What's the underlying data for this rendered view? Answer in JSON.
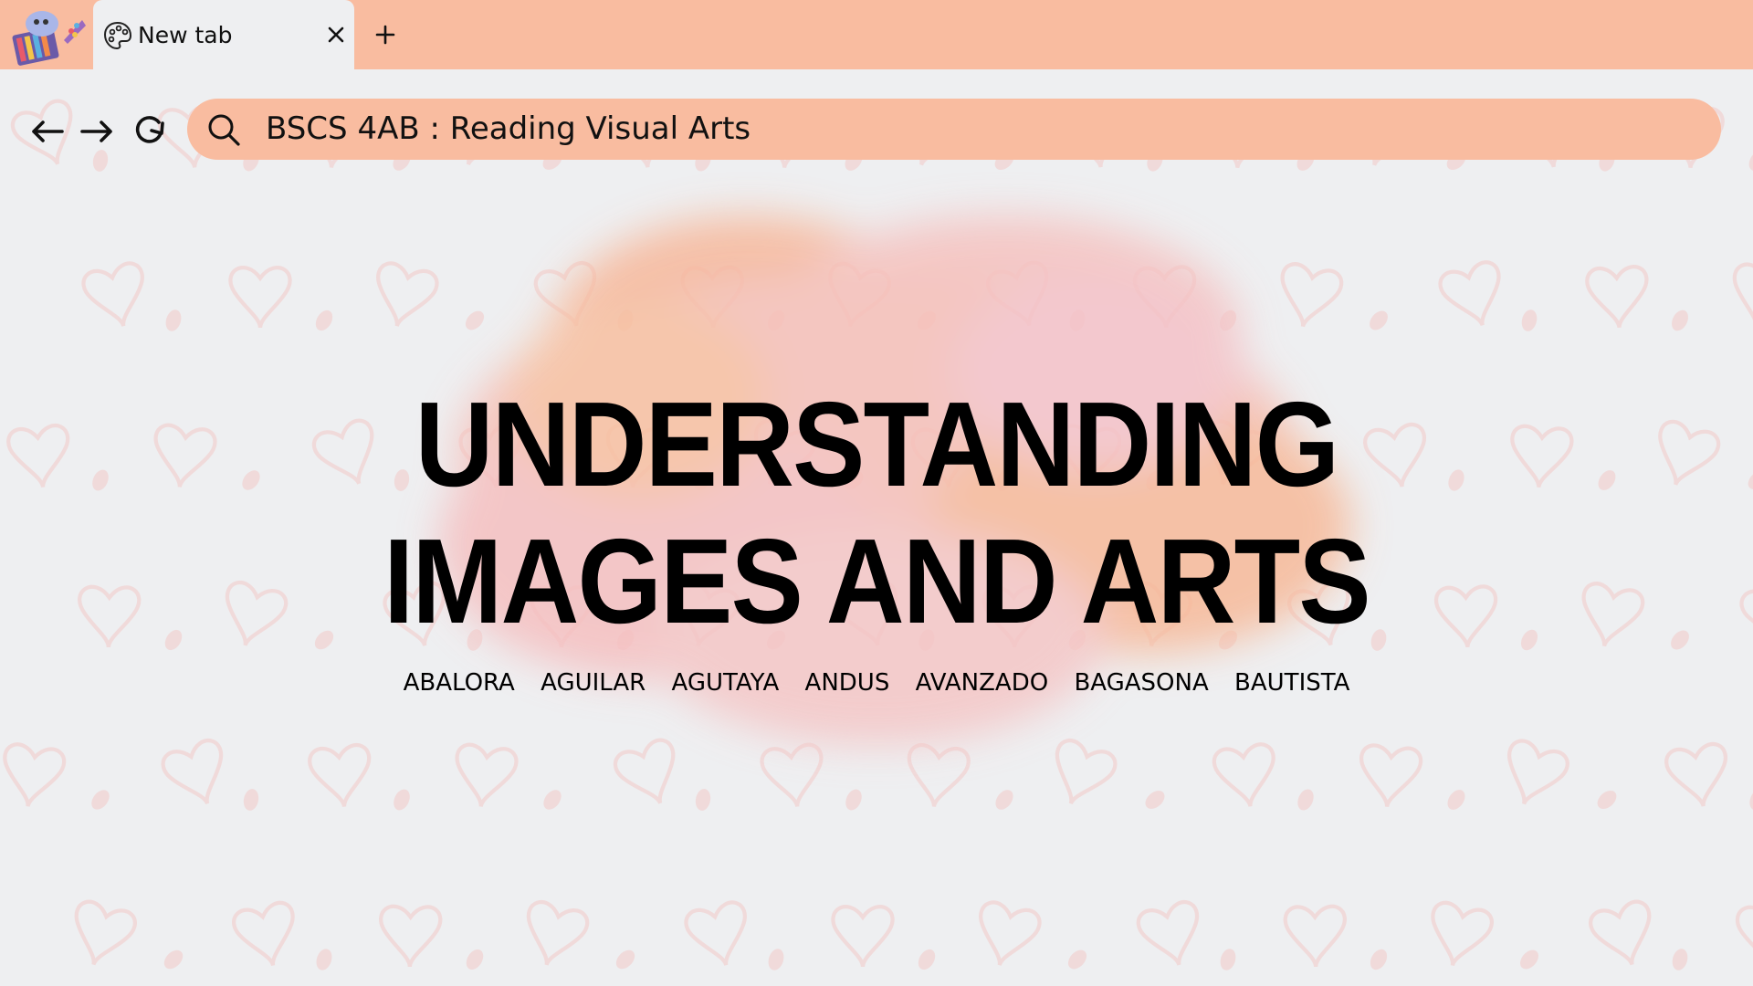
{
  "browser": {
    "tab": {
      "title": "New tab",
      "icon": "palette-icon",
      "close_icon": "close-icon"
    },
    "new_tab_icon": "plus-icon",
    "logo_icon": "art-supplies-logo",
    "nav": {
      "back_icon": "arrow-left-icon",
      "forward_icon": "arrow-right-icon",
      "reload_icon": "reload-icon"
    },
    "address_bar": {
      "icon": "search-icon",
      "value": "BSCS 4AB : Reading Visual Arts"
    }
  },
  "slide": {
    "title_line1": "UNDERSTANDING",
    "title_line2": "IMAGES AND ARTS",
    "names": [
      "ABALORA",
      "AGUILAR",
      "AGUTAYA",
      "ANDUS",
      "AVANZADO",
      "BAGASONA",
      "BAUTISTA"
    ]
  },
  "colors": {
    "chrome_accent": "#f9bca0",
    "page_background": "#eeeff1",
    "heart_pattern": "#f0dada",
    "watercolor_peach": "#f7b79a",
    "watercolor_pink": "#f5c2c0",
    "text": "#000000"
  }
}
